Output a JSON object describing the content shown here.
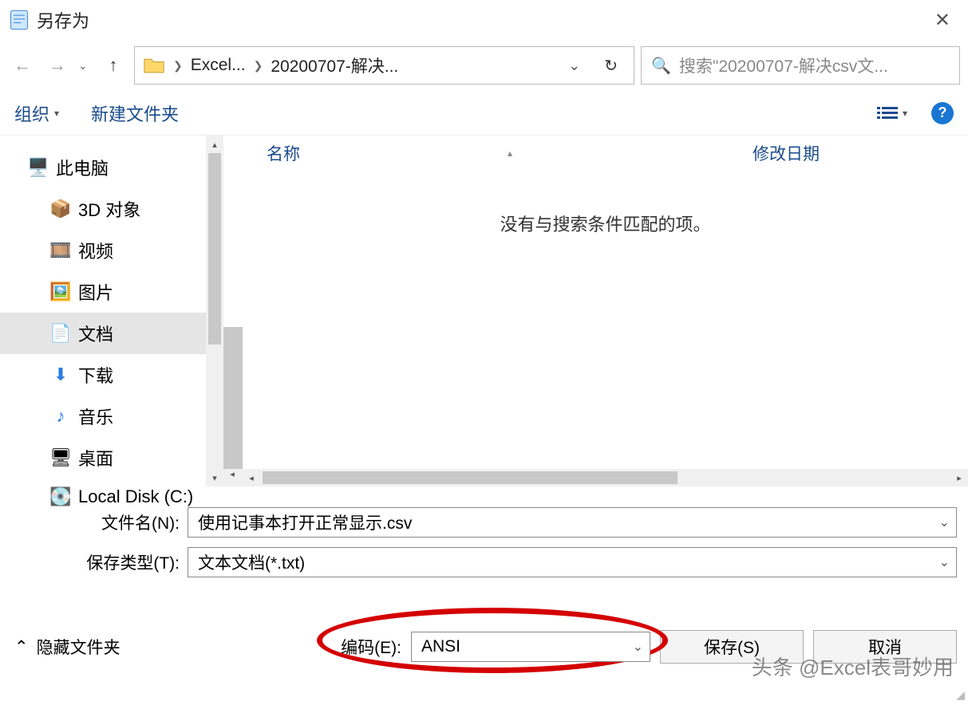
{
  "window": {
    "title": "另存为"
  },
  "breadcrumb": {
    "seg1": "Excel...",
    "seg2": "20200707-解决..."
  },
  "search": {
    "placeholder": "搜索\"20200707-解决csv文..."
  },
  "toolbar": {
    "organize": "组织",
    "newfolder": "新建文件夹"
  },
  "tree": {
    "this_pc": "此电脑",
    "objects3d": "3D 对象",
    "videos": "视频",
    "pictures": "图片",
    "documents": "文档",
    "downloads": "下载",
    "music": "音乐",
    "desktop": "桌面",
    "localdisk": "Local Disk (C:)"
  },
  "columns": {
    "name": "名称",
    "modified": "修改日期"
  },
  "list": {
    "empty": "没有与搜索条件匹配的项。"
  },
  "form": {
    "filename_label": "文件名(N):",
    "filename_value": "使用记事本打开正常显示.csv",
    "savetype_label": "保存类型(T):",
    "savetype_value": "文本文档(*.txt)"
  },
  "bottom": {
    "hide_folders": "隐藏文件夹",
    "encoding_label": "编码(E):",
    "encoding_value": "ANSI",
    "save": "保存(S)",
    "cancel": "取消"
  },
  "watermark": "头条 @Excel表哥妙用"
}
